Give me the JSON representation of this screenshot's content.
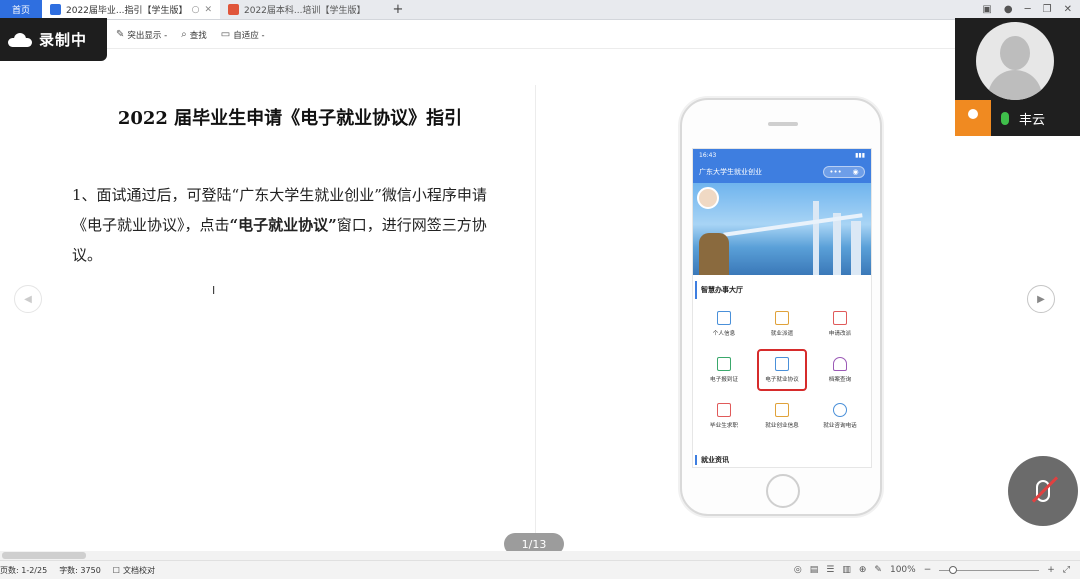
{
  "tabs": {
    "home": "首页",
    "active_label": "2022届毕业...指引【学生版】",
    "inactive_label": "2022届本科...培训【学生版】",
    "add": "+"
  },
  "toolbar": {
    "items": [
      {
        "icon": "pen-icon",
        "label": "突出显示 -"
      },
      {
        "icon": "search-icon",
        "label": "查找"
      },
      {
        "icon": "fit-page-icon",
        "label": "自适应 -"
      }
    ]
  },
  "recording": {
    "label": "录制中"
  },
  "document": {
    "title": "2022 届毕业生申请《电子就业协议》指引",
    "para_a": "1、面试通过后，可登陆“广东大学生就业创业”微信小程序申请《电子就业协议》，点击",
    "para_bold": "“电子就业协议”",
    "para_b": "窗口，进行网签三方协议。"
  },
  "phone": {
    "status_left": "16:43",
    "app_title": "广东大学生就业创业",
    "section1": "智慧办事大厅",
    "items": [
      {
        "label": "个人信息",
        "icon": "id-card-icon",
        "color": "#4a90d9"
      },
      {
        "label": "就业派遣",
        "icon": "document-icon",
        "color": "#e0a23a"
      },
      {
        "label": "申请改派",
        "icon": "edit-doc-icon",
        "color": "#e05a5a"
      },
      {
        "label": "电子报到证",
        "icon": "certificate-icon",
        "color": "#3aa86b"
      },
      {
        "label": "电子就业协议",
        "icon": "agreement-icon",
        "color": "#4a90d9"
      },
      {
        "label": "档案查询",
        "icon": "envelope-icon",
        "color": "#9b59b6"
      },
      {
        "label": "毕业生求职",
        "icon": "graduation-cap-icon",
        "color": "#e05a5a"
      },
      {
        "label": "就业创业信息",
        "icon": "briefcase-icon",
        "color": "#e0a23a"
      },
      {
        "label": "就业咨询电话",
        "icon": "phone-icon",
        "color": "#4a90d9"
      }
    ],
    "section2": "就业资讯"
  },
  "pager": {
    "label": "1/13"
  },
  "statusbar": {
    "pages": "页数: 1-2/25",
    "words": "字数: 3750",
    "proof": "文档校对",
    "zoom": "100%"
  },
  "video": {
    "name": "丰云"
  },
  "colors": {
    "accent": "#2f6fe0",
    "highlight": "#d62b2b",
    "rec_bg": "#1e1e1e"
  }
}
